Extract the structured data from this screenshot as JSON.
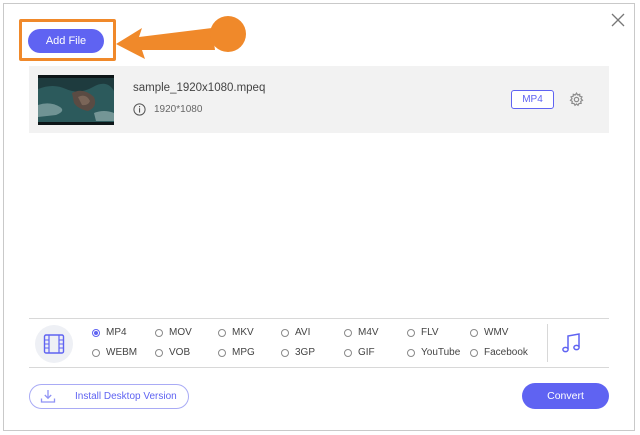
{
  "toolbar": {
    "add_file_label": "Add File"
  },
  "file": {
    "name": "sample_1920x1080.mpeq",
    "resolution": "1920*1080",
    "format_badge": "MP4"
  },
  "formats": {
    "row1": [
      "MP4",
      "MOV",
      "MKV",
      "AVI",
      "M4V",
      "FLV",
      "WMV"
    ],
    "row2": [
      "WEBM",
      "VOB",
      "MPG",
      "3GP",
      "GIF",
      "YouTube",
      "Facebook"
    ],
    "selected": "MP4"
  },
  "footer": {
    "install_label": "Install Desktop Version",
    "convert_label": "Convert"
  },
  "colors": {
    "accent": "#5f63f2",
    "highlight": "#f0892a"
  },
  "icons": {
    "close": "close-icon",
    "info": "info-icon",
    "gear": "gear-icon",
    "video": "film-icon",
    "audio": "music-note-icon",
    "download": "download-icon"
  }
}
